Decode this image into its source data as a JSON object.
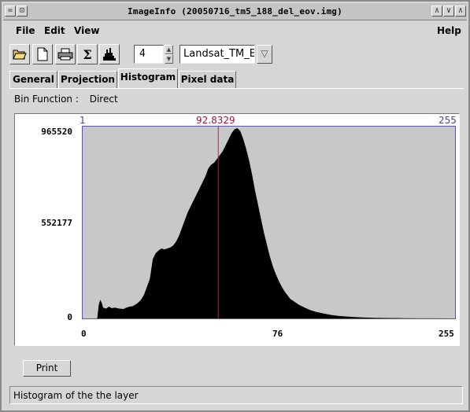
{
  "window": {
    "title": "ImageInfo (20050716_tm5_188_del_eov.img)"
  },
  "titlebar": {
    "left_buttons": [
      "=",
      "⊡"
    ],
    "right_buttons": [
      "∧",
      "∨",
      "∧"
    ]
  },
  "menubar": {
    "items": [
      {
        "label": "File"
      },
      {
        "label": "Edit"
      },
      {
        "label": "View"
      }
    ],
    "help": "Help"
  },
  "toolbar": {
    "icons": [
      "open-folder-icon",
      "new-document-icon",
      "printer-icon",
      "sigma-icon",
      "histogram-icon"
    ],
    "sigma_glyph": "Σ",
    "layer_number": "4",
    "layer_name": "Landsat_TM_E"
  },
  "tabs": [
    {
      "label": "General",
      "active": false
    },
    {
      "label": "Projection",
      "active": false
    },
    {
      "label": "Histogram",
      "active": true
    },
    {
      "label": "Pixel data",
      "active": false
    }
  ],
  "histogram_panel": {
    "bin_function_label": "Bin Function :",
    "bin_function_value": "Direct",
    "top_min": "1",
    "top_mean": "92.8329",
    "top_max": "255",
    "y_ticks": [
      "965520",
      "552177",
      "0"
    ],
    "x_ticks": [
      "0",
      "76",
      "255"
    ],
    "print_label": "Print"
  },
  "chart_data": {
    "type": "histogram",
    "title": "",
    "xlabel": "",
    "ylabel": "",
    "xlim": [
      0,
      255
    ],
    "ylim": [
      0,
      965520
    ],
    "mean_marker": 92.8329,
    "bar_color": "#000000",
    "background_color": "#c8c8c8",
    "mean_line_color": "#c02040",
    "bins": [
      [
        0,
        0
      ],
      [
        10,
        0
      ],
      [
        11,
        68000
      ],
      [
        12,
        95000
      ],
      [
        13,
        80000
      ],
      [
        14,
        55000
      ],
      [
        16,
        50000
      ],
      [
        18,
        60000
      ],
      [
        20,
        52000
      ],
      [
        22,
        55000
      ],
      [
        25,
        50000
      ],
      [
        28,
        48000
      ],
      [
        30,
        55000
      ],
      [
        32,
        60000
      ],
      [
        34,
        62000
      ],
      [
        36,
        70000
      ],
      [
        38,
        80000
      ],
      [
        40,
        95000
      ],
      [
        42,
        120000
      ],
      [
        44,
        160000
      ],
      [
        46,
        200000
      ],
      [
        47,
        250000
      ],
      [
        48,
        300000
      ],
      [
        50,
        330000
      ],
      [
        52,
        345000
      ],
      [
        54,
        355000
      ],
      [
        56,
        350000
      ],
      [
        58,
        355000
      ],
      [
        60,
        360000
      ],
      [
        62,
        370000
      ],
      [
        64,
        390000
      ],
      [
        66,
        420000
      ],
      [
        68,
        460000
      ],
      [
        70,
        500000
      ],
      [
        72,
        540000
      ],
      [
        74,
        570000
      ],
      [
        76,
        600000
      ],
      [
        78,
        630000
      ],
      [
        80,
        660000
      ],
      [
        82,
        690000
      ],
      [
        84,
        720000
      ],
      [
        86,
        760000
      ],
      [
        88,
        780000
      ],
      [
        90,
        790000
      ],
      [
        92,
        810000
      ],
      [
        94,
        830000
      ],
      [
        96,
        850000
      ],
      [
        98,
        880000
      ],
      [
        100,
        910000
      ],
      [
        102,
        940000
      ],
      [
        104,
        960000
      ],
      [
        106,
        965520
      ],
      [
        108,
        950000
      ],
      [
        110,
        910000
      ],
      [
        112,
        860000
      ],
      [
        114,
        800000
      ],
      [
        116,
        730000
      ],
      [
        118,
        650000
      ],
      [
        120,
        580000
      ],
      [
        122,
        510000
      ],
      [
        124,
        440000
      ],
      [
        126,
        380000
      ],
      [
        128,
        320000
      ],
      [
        130,
        270000
      ],
      [
        132,
        230000
      ],
      [
        134,
        195000
      ],
      [
        136,
        165000
      ],
      [
        138,
        140000
      ],
      [
        140,
        120000
      ],
      [
        142,
        100000
      ],
      [
        145,
        85000
      ],
      [
        148,
        70000
      ],
      [
        152,
        55000
      ],
      [
        156,
        42000
      ],
      [
        160,
        33000
      ],
      [
        165,
        25000
      ],
      [
        170,
        18000
      ],
      [
        175,
        13000
      ],
      [
        180,
        10000
      ],
      [
        186,
        7000
      ],
      [
        192,
        5000
      ],
      [
        200,
        3000
      ],
      [
        210,
        2000
      ],
      [
        220,
        1000
      ],
      [
        230,
        500
      ],
      [
        240,
        200
      ],
      [
        255,
        0
      ]
    ]
  },
  "status": {
    "text": "Histogram of the the layer"
  }
}
